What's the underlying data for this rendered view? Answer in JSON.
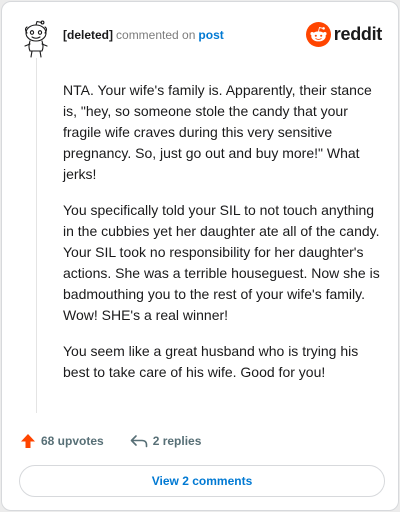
{
  "header": {
    "author": "[deleted]",
    "verb": "commented on",
    "post_link": "post",
    "brand": "reddit",
    "brand_color": "#ff4500"
  },
  "comment": {
    "paragraphs": [
      "NTA. Your wife's family is. Apparently, their stance is, \"hey, so someone stole the candy that your fragile wife craves during this very sensitive pregnancy. So, just go out and buy more!\" What jerks!",
      "You specifically told your SIL to not touch anything in the cubbies yet her daughter ate all of the candy. Your SIL took no responsibility for her daughter's actions. She was a terrible houseguest. Now she is badmouthing you to the rest of your wife's family. Wow! SHE's a real winner!",
      "You seem like a great husband who is trying his best to take care of his wife. Good for you!"
    ]
  },
  "actions": {
    "upvotes": "68 upvotes",
    "replies": "2 replies",
    "upvote_icon": "upvote-arrow",
    "reply_icon": "reply-arrow"
  },
  "footer": {
    "view_comments": "View 2 comments"
  }
}
